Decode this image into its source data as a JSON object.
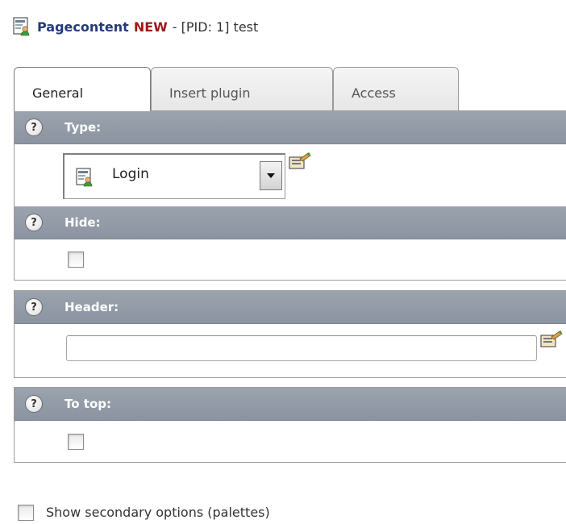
{
  "header": {
    "title_main": "Pagecontent",
    "title_new": "NEW",
    "title_rest": "- [PID: 1] test"
  },
  "tabs": [
    {
      "label": "General",
      "active": true
    },
    {
      "label": "Insert plugin",
      "active": false
    },
    {
      "label": "Access",
      "active": false
    }
  ],
  "sections": {
    "type": {
      "label": "Type:",
      "help_glyph": "?",
      "selected_value": "Login"
    },
    "hide": {
      "label": "Hide:",
      "help_glyph": "?",
      "checked": false
    },
    "header_field": {
      "label": "Header:",
      "help_glyph": "?",
      "value": ""
    },
    "to_top": {
      "label": "To top:",
      "help_glyph": "?",
      "checked": false
    }
  },
  "footer": {
    "secondary_options_label": "Show secondary options (palettes)",
    "checked": false
  },
  "icons": {
    "document": "content-element-icon",
    "help": "help-icon",
    "edit": "edit-wizard-icon",
    "dropdown": "chevron-down-icon"
  },
  "colors": {
    "title_blue": "#243a7a",
    "new_red": "#a01818",
    "section_bar": "#8b94a0"
  }
}
